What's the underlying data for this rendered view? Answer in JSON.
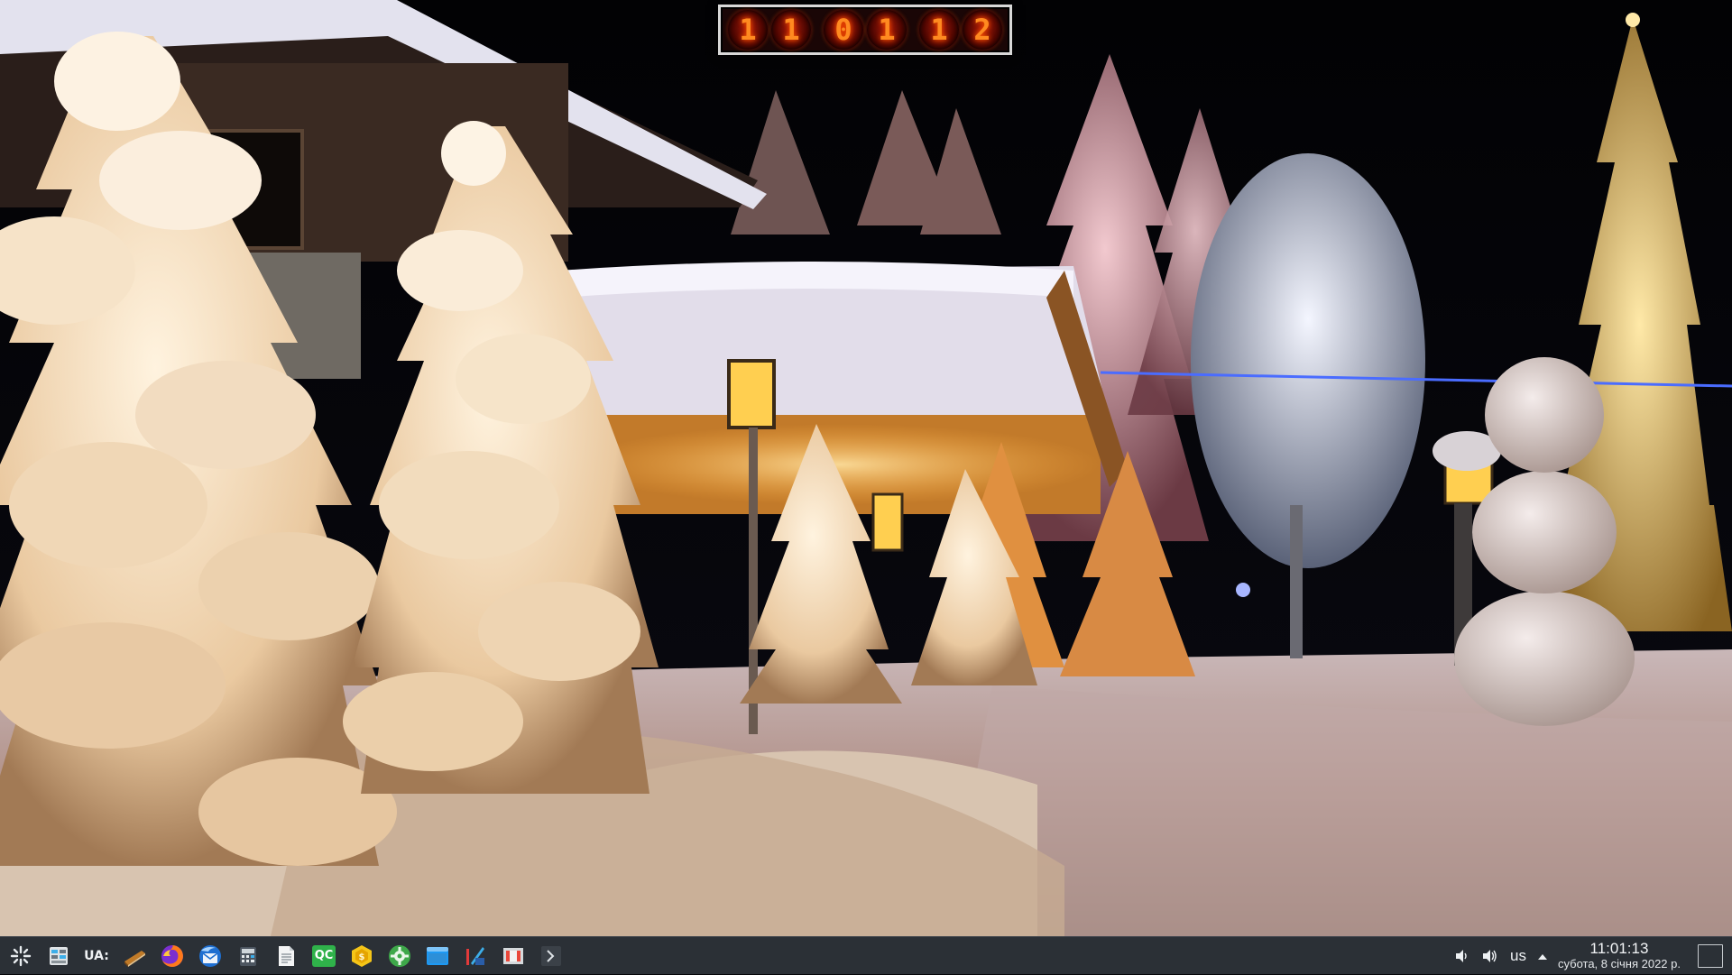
{
  "nixie_clock": {
    "digits": [
      "1",
      "1",
      "0",
      "1",
      "1",
      "2"
    ]
  },
  "taskbar": {
    "launchers": [
      {
        "name": "application-launcher-icon"
      },
      {
        "name": "system-settings-icon"
      },
      {
        "name": "ua-keyboard-icon",
        "label": "UA:"
      },
      {
        "name": "book-reader-icon"
      },
      {
        "name": "firefox-icon"
      },
      {
        "name": "thunderbird-icon"
      },
      {
        "name": "calculator-icon"
      },
      {
        "name": "text-editor-icon"
      },
      {
        "name": "qc-app-icon",
        "label": "QC"
      },
      {
        "name": "coin-app-icon"
      },
      {
        "name": "gear-app-icon"
      },
      {
        "name": "file-manager-icon"
      },
      {
        "name": "image-editor-icon"
      },
      {
        "name": "screenshot-icon"
      },
      {
        "name": "terminal-icon"
      }
    ]
  },
  "tray": {
    "keyboard_layout": "us",
    "time": "11:01:13",
    "date": "субота, 8 січня 2022 р."
  },
  "colors": {
    "taskbar_bg": "#2b3036",
    "nixie_glow": "#ff8a20",
    "accent_blue": "#3daee9"
  }
}
